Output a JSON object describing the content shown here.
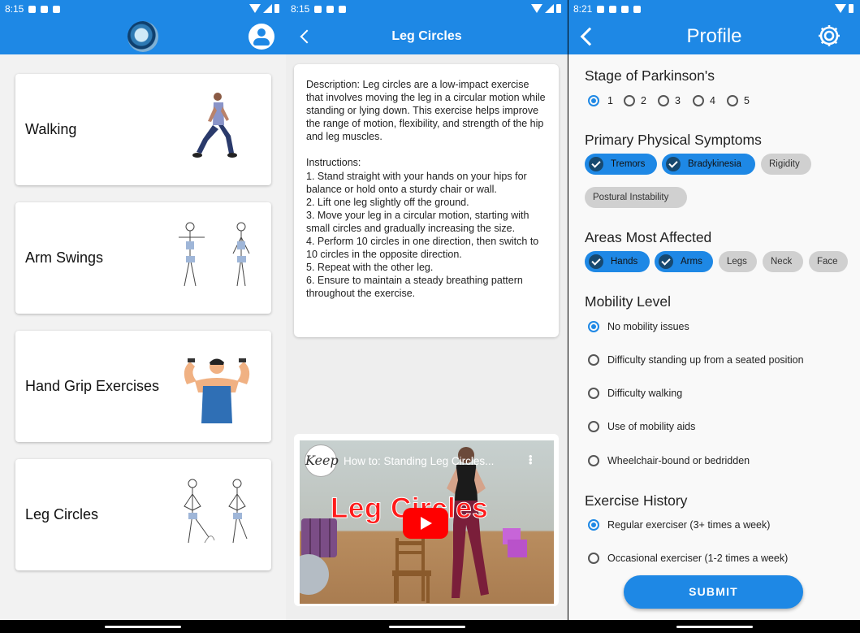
{
  "screen1": {
    "status_time": "8:15",
    "exercises": [
      {
        "name": "Walking"
      },
      {
        "name": "Arm Swings"
      },
      {
        "name": "Hand Grip Exercises"
      },
      {
        "name": "Leg Circles"
      }
    ],
    "colors": {
      "primary": "#1e88e5",
      "background": "#f2f2f2"
    }
  },
  "screen2": {
    "status_time": "8:15",
    "title": "Leg Circles",
    "description": "Description: Leg circles are a low-impact exercise that involves moving the leg in a circular motion while standing or lying down. This exercise helps improve the range of motion, flexibility, and strength of the hip and leg muscles.",
    "instructions_heading": "Instructions:",
    "instructions": [
      "1. Stand straight with your hands on your hips for balance or hold onto a sturdy chair or wall.",
      "2. Lift one leg slightly off the ground.",
      "3. Move your leg in a circular motion, starting with small circles and gradually increasing the size.",
      "4. Perform 10 circles in one direction, then switch to 10 circles in the opposite direction.",
      "5. Repeat with the other leg.",
      "6. Ensure to maintain a steady breathing pattern throughout the exercise."
    ],
    "video": {
      "title": "How to: Standing Leg Circles...",
      "overlay_text": "Leg Circles",
      "channel_logo_text": "Keep"
    }
  },
  "screen3": {
    "status_time": "8:21",
    "title": "Profile",
    "stage": {
      "heading": "Stage of Parkinson's",
      "options": [
        "1",
        "2",
        "3",
        "4",
        "5"
      ],
      "selected": "1"
    },
    "symptoms": {
      "heading": "Primary Physical Symptoms",
      "chips": [
        {
          "label": "Tremors",
          "selected": true
        },
        {
          "label": "Bradykinesia",
          "selected": true
        },
        {
          "label": "Rigidity",
          "selected": false
        },
        {
          "label": "Postural Instability",
          "selected": false
        }
      ]
    },
    "areas": {
      "heading": "Areas Most Affected",
      "chips": [
        {
          "label": "Hands",
          "selected": true
        },
        {
          "label": "Arms",
          "selected": true
        },
        {
          "label": "Legs",
          "selected": false
        },
        {
          "label": "Neck",
          "selected": false
        },
        {
          "label": "Face",
          "selected": false
        }
      ]
    },
    "mobility": {
      "heading": "Mobility Level",
      "options": [
        "No mobility issues",
        "Difficulty standing up from a seated position",
        "Difficulty walking",
        "Use of mobility aids",
        "Wheelchair-bound or bedridden"
      ],
      "selected": "No mobility issues"
    },
    "history": {
      "heading": "Exercise History",
      "options": [
        "Regular exerciser (3+ times a week)",
        "Occasional exerciser (1-2 times a week)"
      ],
      "selected": "Regular exerciser (3+ times a week)"
    },
    "submit_label": "SUBMIT"
  }
}
